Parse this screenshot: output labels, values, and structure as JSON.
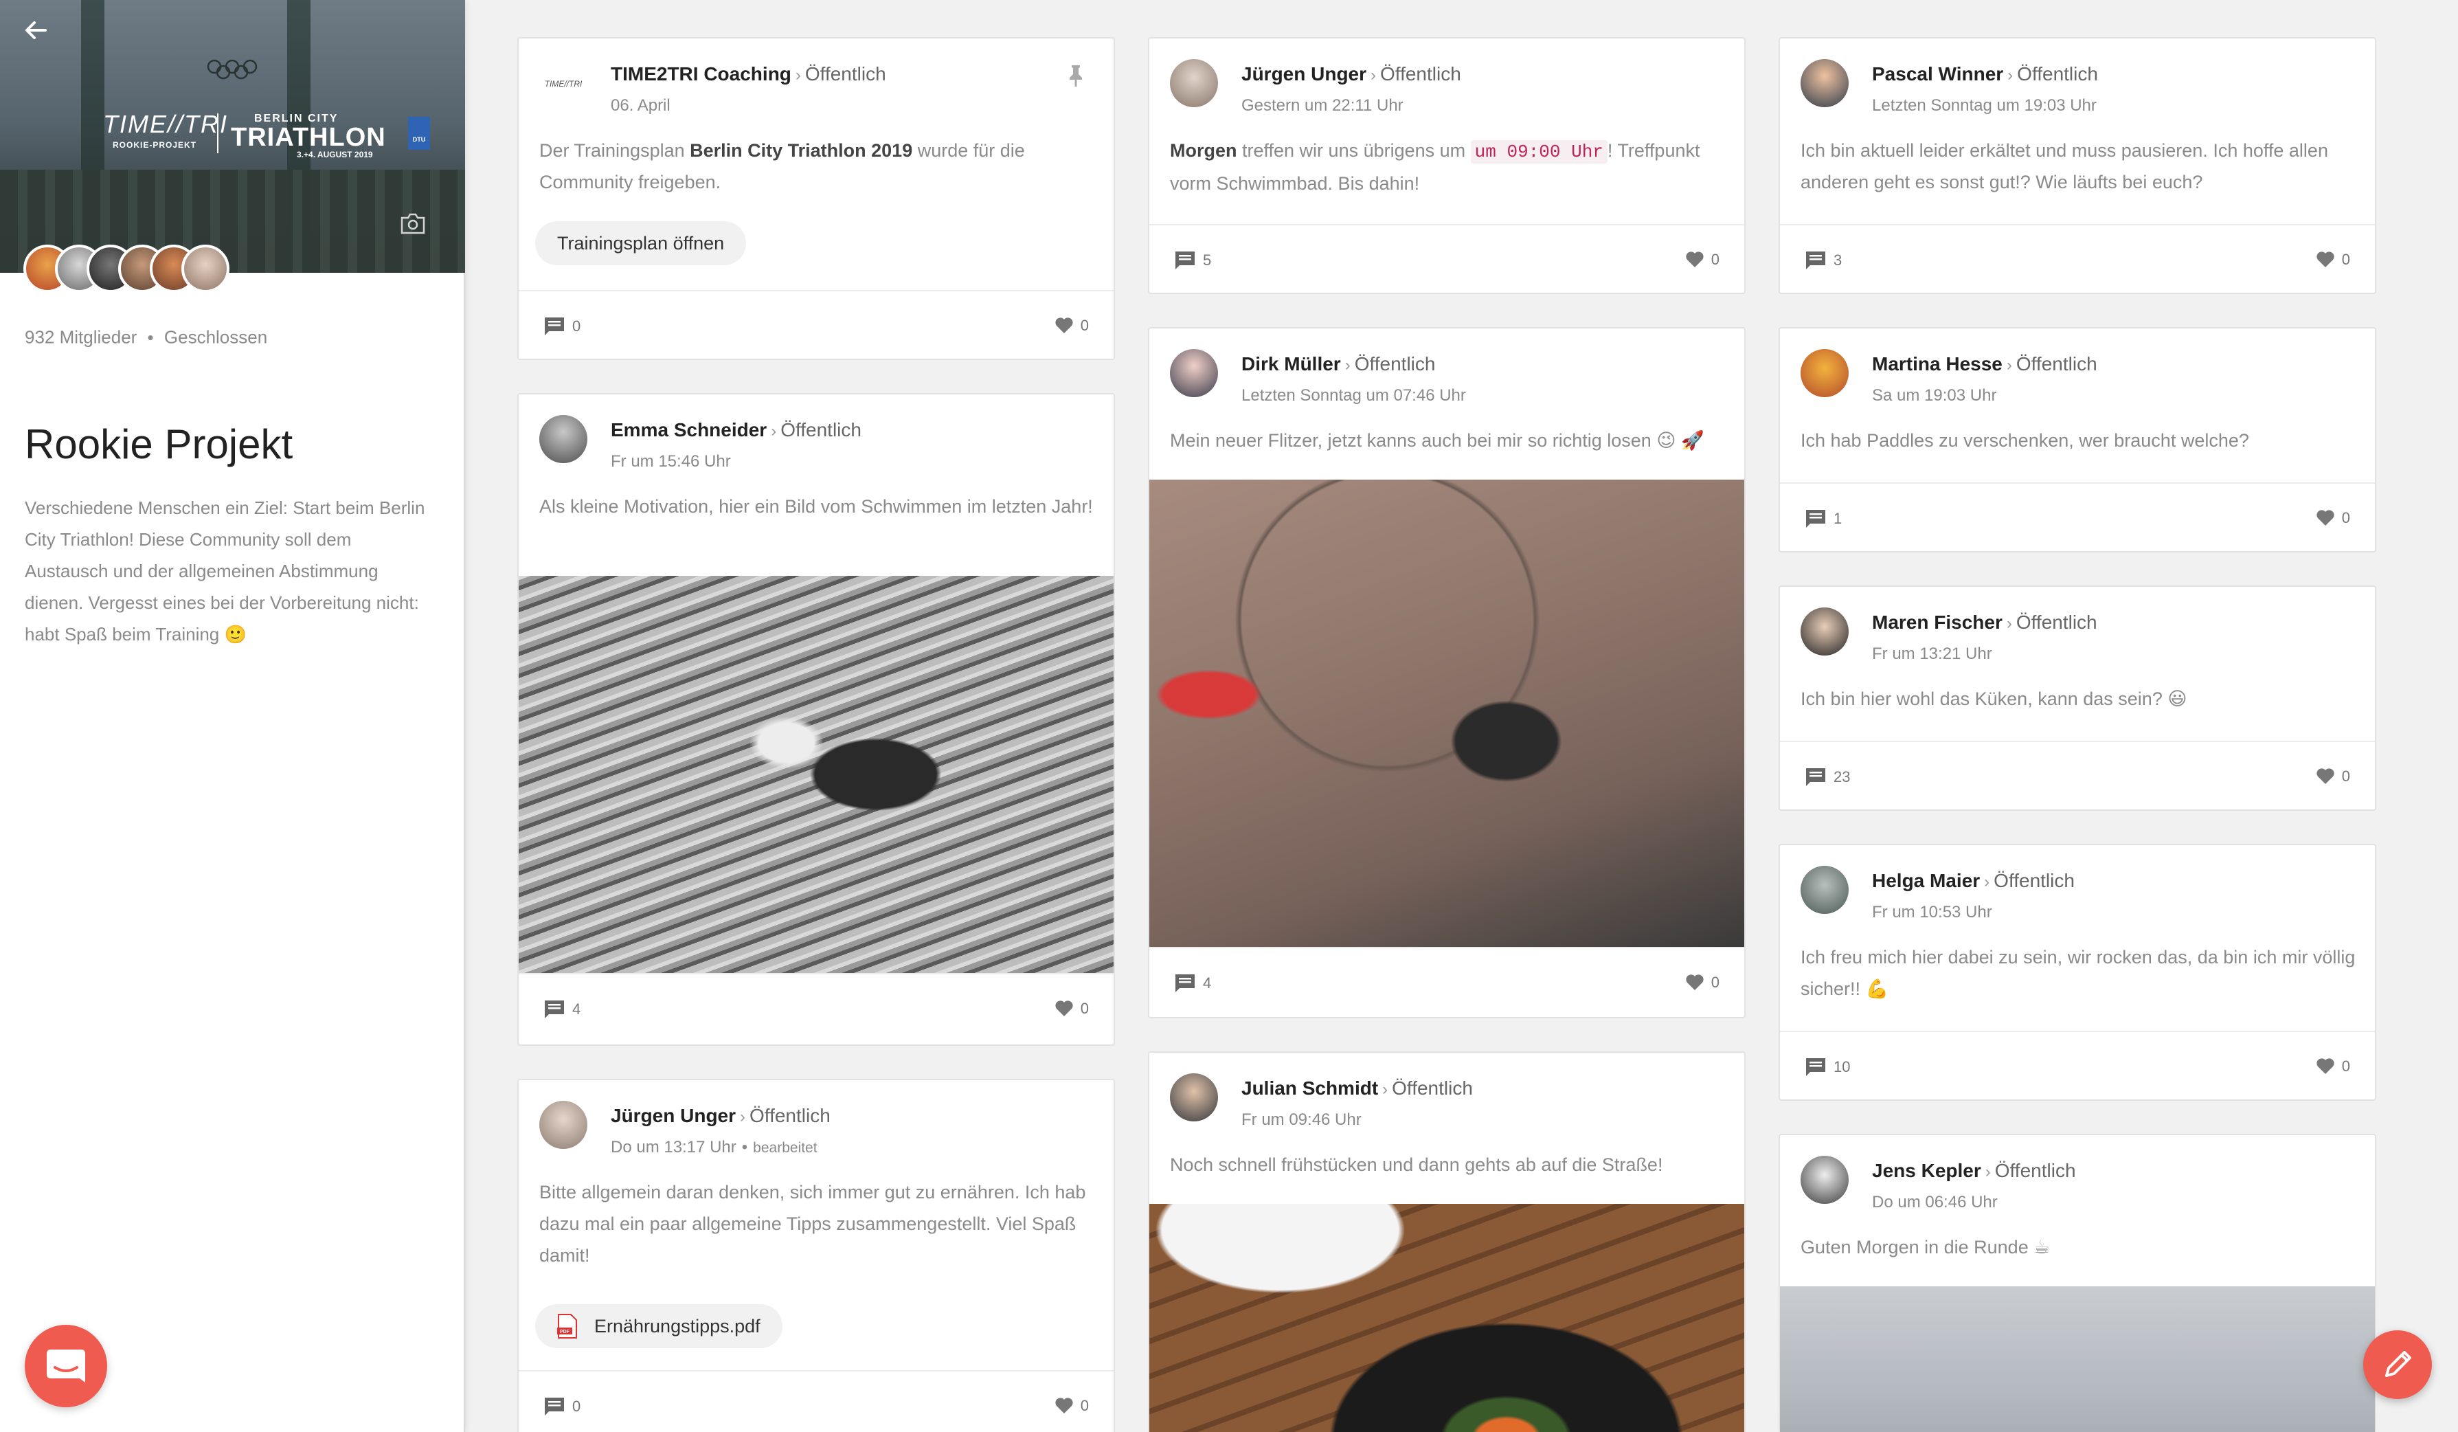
{
  "sidebar": {
    "cover": {
      "logo_left_big": "TIME//TRI",
      "logo_left_small": "ROOKIE-PROJEKT",
      "logo_right_l1": "BERLIN CITY",
      "logo_right_l2": "TRIATHLON",
      "logo_right_l3": "3.+4. AUGUST 2019",
      "dtu": "DTU"
    },
    "members": "932 Mitglieder",
    "privacy": "Geschlossen",
    "title": "Rookie Projekt",
    "description": "Verschiedene Menschen ein Ziel: Start beim Berlin City Triathlon! Diese Community soll dem Austausch und der allgemeinen Abstimmung dienen. Vergesst eines bei der Vorbereitung nicht: habt Spaß beim Training 🙂"
  },
  "posts": {
    "p1": {
      "author": "TIME2TRI Coaching",
      "visibility": "Öffentlich",
      "time": "06. April",
      "text_before": "Der Trainingsplan ",
      "text_bold": "Berlin City Triathlon 2019",
      "text_after": " wurde für die Community freigeben.",
      "button": "Trainingsplan öffnen",
      "comments": "0",
      "likes": "0"
    },
    "p2": {
      "author": "Emma Schneider",
      "visibility": "Öffentlich",
      "time": "Fr um 15:46 Uhr",
      "text": "Als kleine Motivation, hier ein Bild vom Schwimmen im letzten Jahr!",
      "comments": "4",
      "likes": "0"
    },
    "p3": {
      "author": "Jürgen Unger",
      "visibility": "Öffentlich",
      "time": "Do um 13:17 Uhr",
      "edited": "bearbeitet",
      "text": "Bitte allgemein daran denken, sich immer gut zu ernähren. Ich hab dazu mal ein paar allgemeine Tipps zusammengestellt. Viel Spaß damit!",
      "attachment": "Ernährungstipps.pdf",
      "comments": "0",
      "likes": "0"
    },
    "p4": {
      "author": "Jürgen Unger",
      "visibility": "Öffentlich",
      "time": "Gestern um 22:11 Uhr",
      "text_bold": "Morgen",
      "text_mid": " treffen wir uns übrigens um ",
      "text_code": "um 09:00 Uhr",
      "text_after": "! Treffpunkt vorm Schwimmbad. Bis dahin!",
      "comments": "5",
      "likes": "0"
    },
    "p5": {
      "author": "Dirk Müller",
      "visibility": "Öffentlich",
      "time": "Letzten Sonntag um 07:46 Uhr",
      "text": "Mein neuer Flitzer, jetzt kanns auch bei mir so richtig losen 😉 🚀",
      "comments": "4",
      "likes": "0"
    },
    "p6": {
      "author": "Julian Schmidt",
      "visibility": "Öffentlich",
      "time": "Fr um 09:46 Uhr",
      "text": "Noch schnell frühstücken und dann gehts ab auf die Straße!"
    },
    "p7": {
      "author": "Pascal Winner",
      "visibility": "Öffentlich",
      "time": "Letzten Sonntag um 19:03 Uhr",
      "text": "Ich bin aktuell leider erkältet und muss pausieren. Ich hoffe allen anderen geht es sonst gut!? Wie läufts bei euch?",
      "comments": "3",
      "likes": "0"
    },
    "p8": {
      "author": "Martina Hesse",
      "visibility": "Öffentlich",
      "time": "Sa um 19:03 Uhr",
      "text": "Ich hab Paddles zu verschenken, wer braucht welche?",
      "comments": "1",
      "likes": "0"
    },
    "p9": {
      "author": "Maren Fischer",
      "visibility": "Öffentlich",
      "time": "Fr um 13:21 Uhr",
      "text": "Ich bin hier wohl das Küken, kann das sein? 😃",
      "comments": "23",
      "likes": "0"
    },
    "p10": {
      "author": "Helga Maier",
      "visibility": "Öffentlich",
      "time": "Fr um 10:53 Uhr",
      "text": "Ich freu mich hier dabei zu sein, wir rocken das, da bin ich mir völlig sicher!! 💪",
      "comments": "10",
      "likes": "0"
    },
    "p11": {
      "author": "Jens Kepler",
      "visibility": "Öffentlich",
      "time": "Do um 06:46 Uhr",
      "text": "Guten Morgen in die Runde ☕"
    }
  },
  "colors": {
    "accent": "#f05b4f",
    "muted": "#8a8a8a",
    "code": "#c0245b"
  },
  "icons": [
    "back-arrow-icon",
    "camera-icon",
    "pin-icon",
    "comment-icon",
    "heart-icon",
    "pdf-icon",
    "chat-icon",
    "pencil-icon"
  ]
}
